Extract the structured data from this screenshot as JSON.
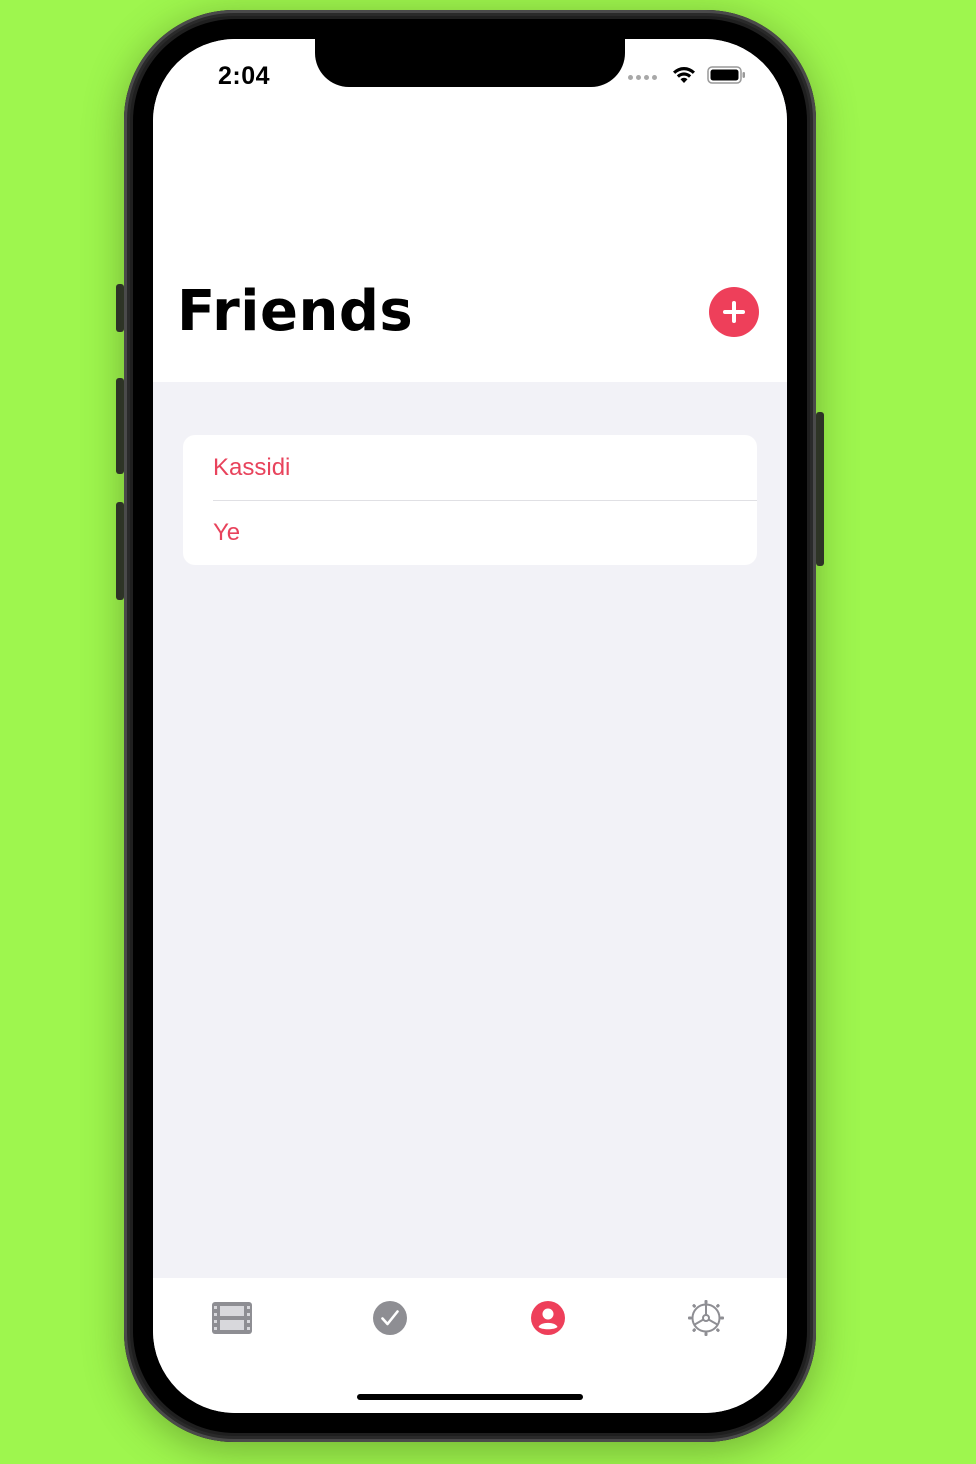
{
  "status_bar": {
    "time": "2:04"
  },
  "header": {
    "title": "Friends",
    "add_icon": "plus-circle-icon"
  },
  "friends": [
    {
      "name": "Kassidi"
    },
    {
      "name": "Ye"
    }
  ],
  "tab_bar": {
    "tabs": [
      {
        "icon": "film-icon",
        "active": false
      },
      {
        "icon": "checkmark-circle-icon",
        "active": false
      },
      {
        "icon": "person-circle-icon",
        "active": true
      },
      {
        "icon": "gear-icon",
        "active": false
      }
    ]
  },
  "colors": {
    "accent": "#ee3f5a",
    "list_text": "#e8435c",
    "inactive_icon": "#8e8e93",
    "background": "#f2f2f7",
    "outer_background": "#9ef64e"
  }
}
